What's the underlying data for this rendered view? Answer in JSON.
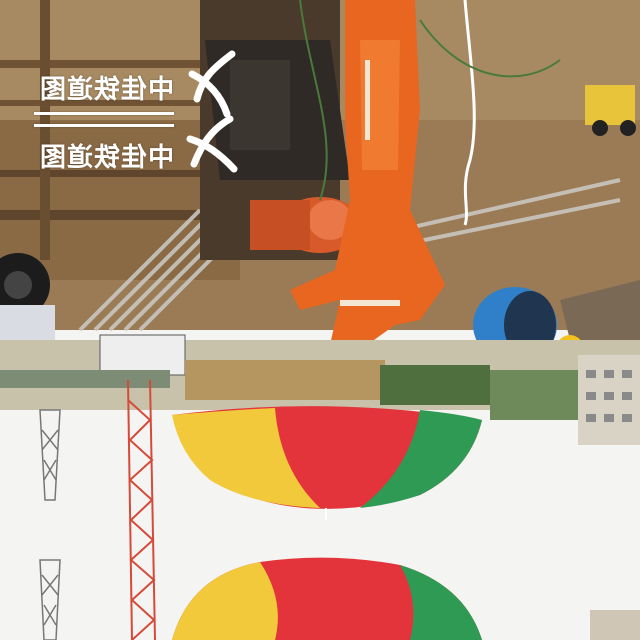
{
  "watermark": {
    "text_upper": "中佳铁道图",
    "text_lower": "中佳铁道图",
    "logo_icon": "stylized-cjk-logo-icon"
  },
  "colors": {
    "safety_orange": "#e8661f",
    "umbrella_red": "#e2343a",
    "umbrella_yellow": "#f1c93b",
    "umbrella_green": "#2e9a54",
    "sky": "#f4f4f2",
    "wall_brown": "#8a6a45"
  }
}
